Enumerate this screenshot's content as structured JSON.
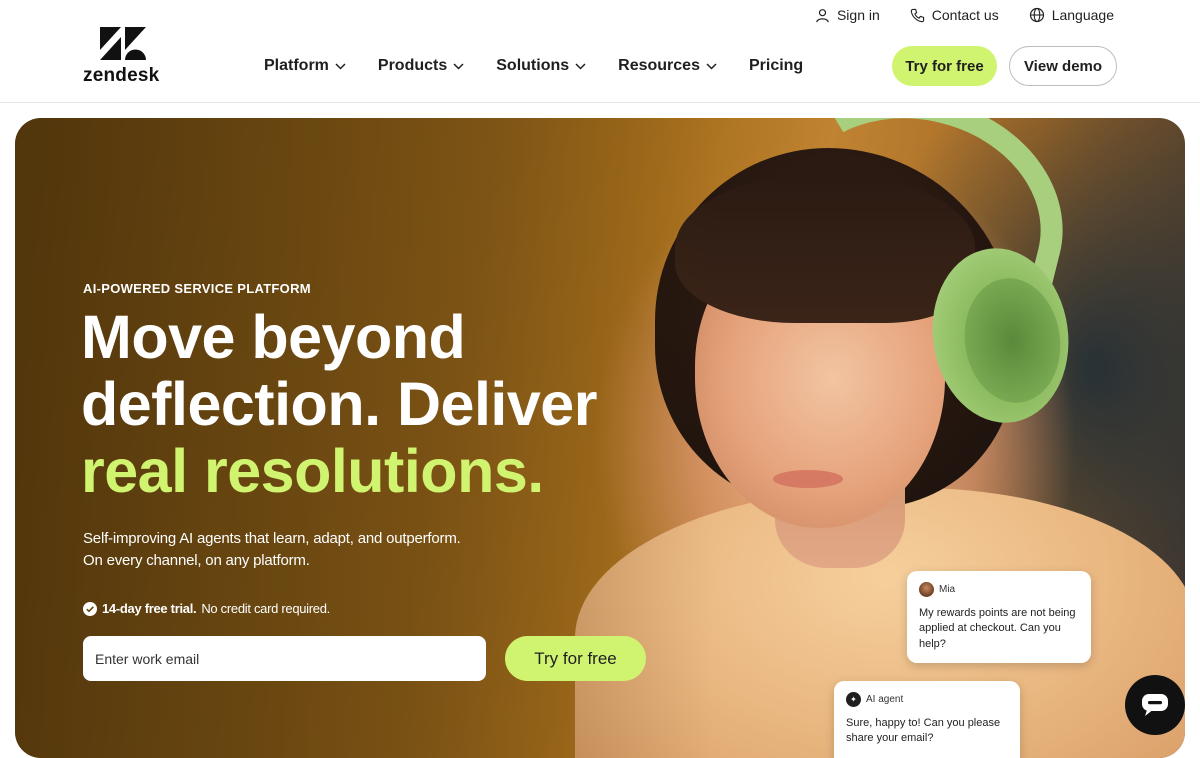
{
  "brand": {
    "logo_text": "zendesk"
  },
  "utility": {
    "sign_in": "Sign in",
    "contact_us": "Contact us",
    "language": "Language"
  },
  "nav": {
    "items": [
      {
        "label": "Platform",
        "has_dropdown": true
      },
      {
        "label": "Products",
        "has_dropdown": true
      },
      {
        "label": "Solutions",
        "has_dropdown": true
      },
      {
        "label": "Resources",
        "has_dropdown": true
      },
      {
        "label": "Pricing",
        "has_dropdown": false
      }
    ],
    "try_for_free": "Try for free",
    "view_demo": "View demo"
  },
  "hero": {
    "eyebrow": "AI-POWERED SERVICE PLATFORM",
    "headline_line1": "Move beyond",
    "headline_line2": "deflection. Deliver",
    "headline_accent": "real resolutions.",
    "sub_line1": "Self-improving AI agents that learn, adapt, and outperform.",
    "sub_line2": "On every channel, on any platform.",
    "trial_bold": "14-day free trial.",
    "trial_rest": "No credit card required.",
    "email_placeholder": "Enter work email",
    "cta": "Try for free"
  },
  "chat": {
    "customer_name": "Mia",
    "customer_message": "My rewards points are not being applied at checkout. Can you help?",
    "agent_name": "AI agent",
    "agent_message": "Sure, happy to! Can you please share your email?"
  },
  "colors": {
    "accent": "#d1f470",
    "text_dark": "#1f1f1f",
    "hero_brown": "#8d5f18"
  },
  "icons": {
    "sign_in": "user-icon",
    "contact": "phone-icon",
    "language": "globe-icon",
    "dropdown": "chevron-down-icon",
    "trial": "check-circle-icon",
    "chat": "chat-bubble-icon"
  }
}
